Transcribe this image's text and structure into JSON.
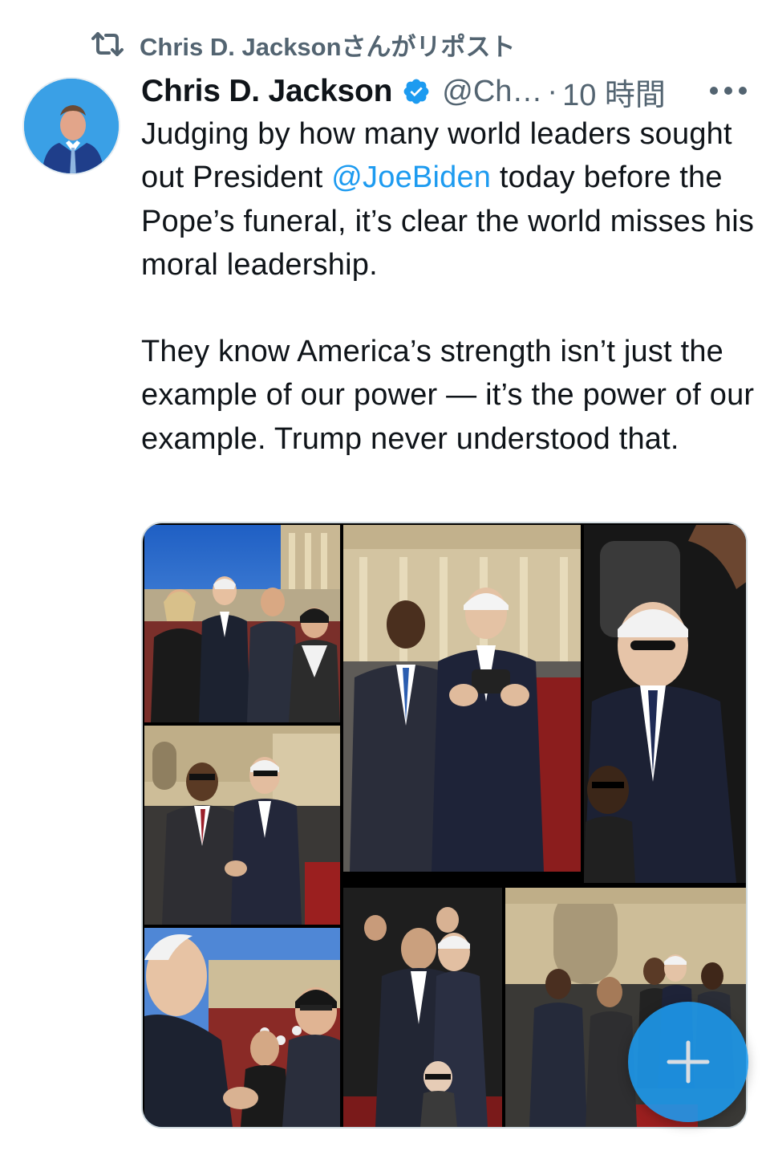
{
  "repost": {
    "text": "Chris D. Jacksonさんがリポスト",
    "icon": "repost-icon"
  },
  "tweet": {
    "author": "Chris D. Jackson",
    "verified": true,
    "handle": "@Ch…",
    "separator": "·",
    "time": "10 時間",
    "paragraph1_part1": "Judging by how many world leaders sought out President ",
    "mention": "@JoeBiden",
    "paragraph1_part2": " today before the Pope’s funeral, it’s clear the world misses his moral leadership.",
    "paragraph2": "They know America’s strength isn’t just the example of our power — it’s the power of our example. Trump never understood that."
  },
  "media": {
    "count": 7
  },
  "colors": {
    "accent": "#1d9bf0",
    "text": "#0f1419",
    "secondary": "#536471"
  }
}
